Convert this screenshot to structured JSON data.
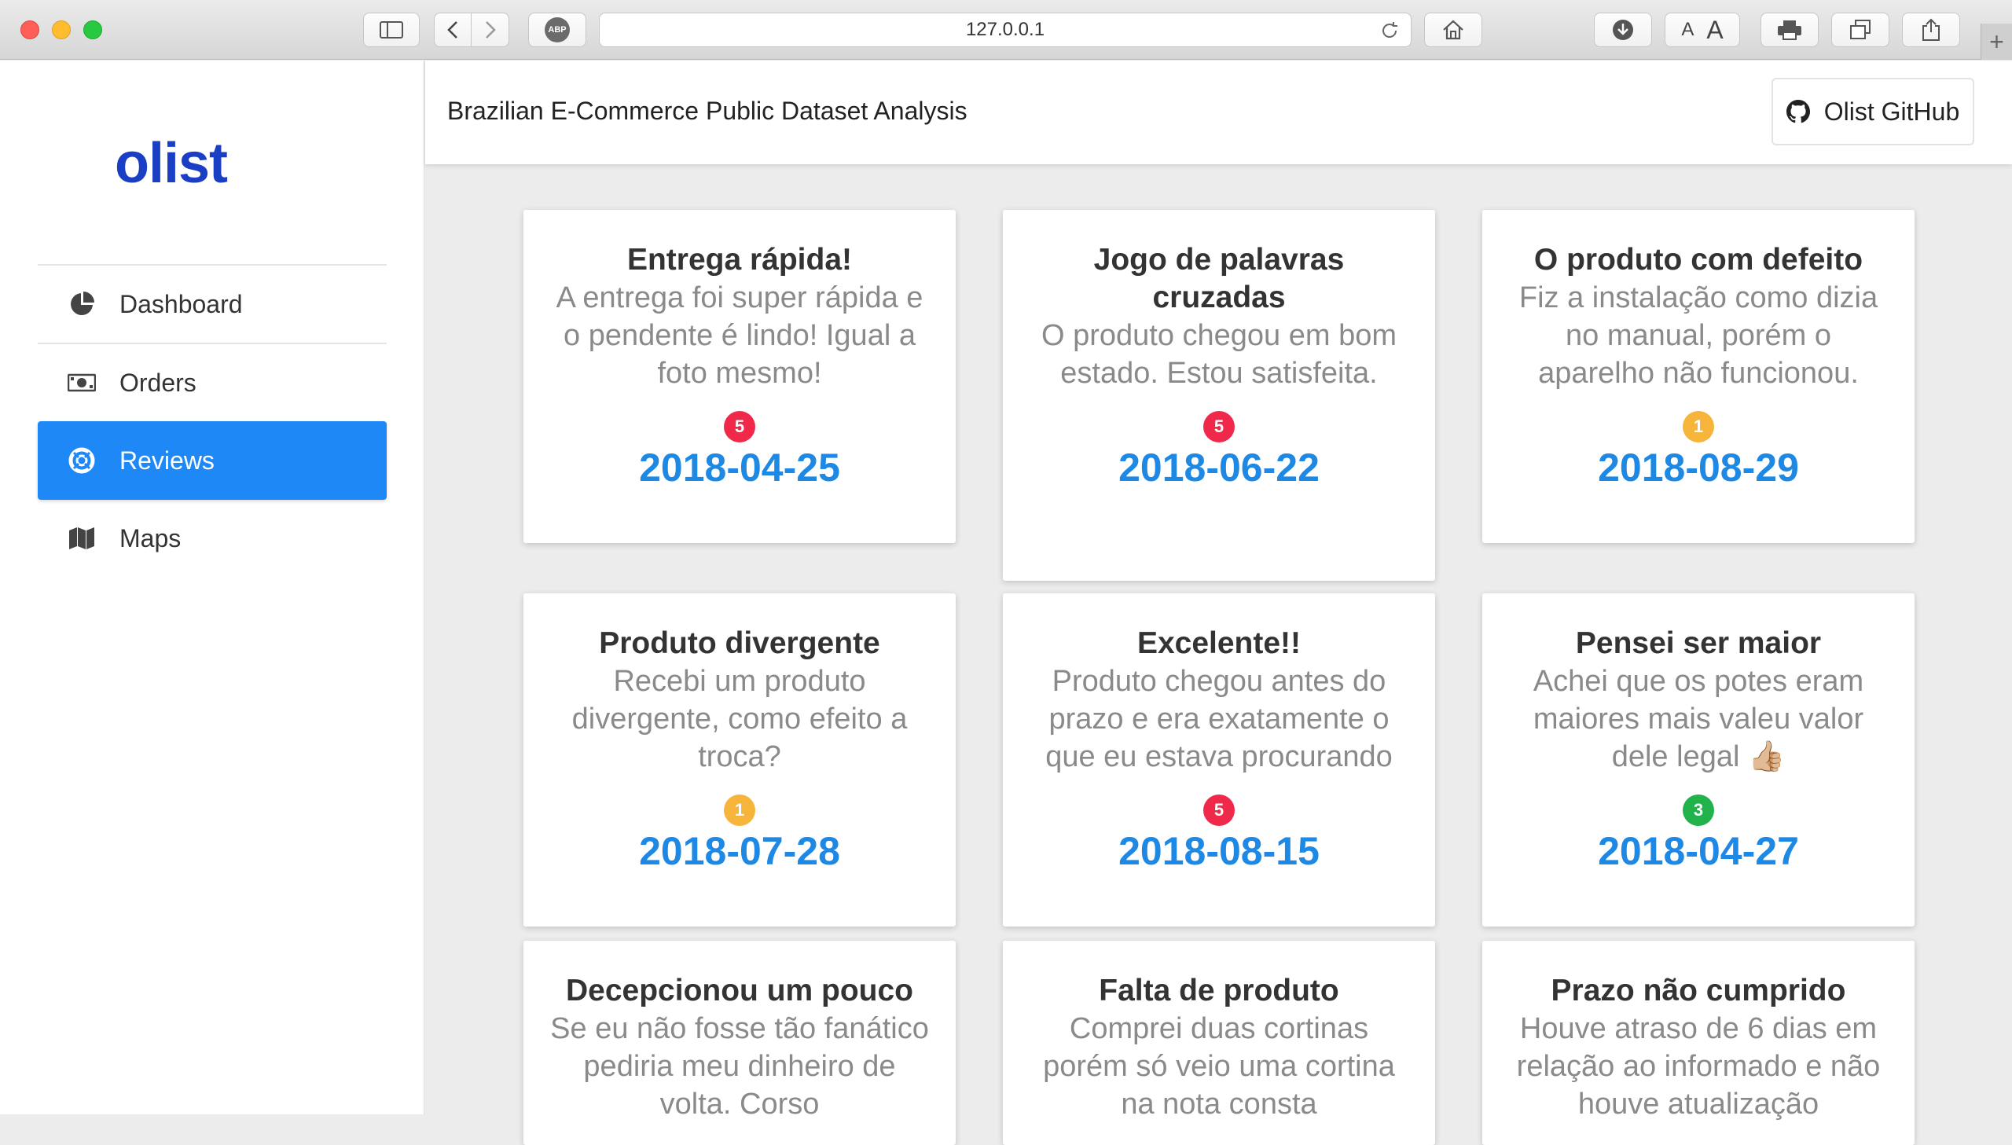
{
  "browser": {
    "url": "127.0.0.1",
    "abp_label": "ABP",
    "font_small": "A",
    "font_large": "A",
    "new_tab": "+"
  },
  "sidebar": {
    "logo": "olist",
    "items": [
      {
        "label": "Dashboard",
        "icon": "pie-chart-icon"
      },
      {
        "label": "Orders",
        "icon": "money-bill-icon"
      },
      {
        "label": "Reviews",
        "icon": "life-ring-icon",
        "active": true
      },
      {
        "label": "Maps",
        "icon": "map-icon"
      }
    ]
  },
  "header": {
    "title": "Brazilian E-Commerce Public Dataset Analysis",
    "github_label": "Olist GitHub"
  },
  "colors": {
    "accent": "#1e88f7",
    "logo": "#1a3fc4",
    "badge_red": "#f0294a",
    "badge_orange": "#f7b43a",
    "badge_green": "#22b24c"
  },
  "reviews": [
    {
      "title": "Entrega rápida!",
      "text": "A entrega foi super rápida e o pendente é lindo! Igual a foto mesmo!",
      "score": "5",
      "score_color": "red",
      "date": "2018-04-25"
    },
    {
      "title": "Jogo de palavras cruzadas",
      "text": "O produto chegou em bom estado. Estou satisfeita.",
      "score": "5",
      "score_color": "red",
      "date": "2018-06-22"
    },
    {
      "title": "O produto com defeito",
      "text": "Fiz a instalação como dizia no manual, porém o aparelho não funcionou.",
      "score": "1",
      "score_color": "orange",
      "date": "2018-08-29"
    },
    {
      "title": "Produto divergente",
      "text": "Recebi um produto divergente, como efeito a troca?",
      "score": "1",
      "score_color": "orange",
      "date": "2018-07-28"
    },
    {
      "title": "Excelente!!",
      "text": "Produto chegou antes do prazo e era exatamente o que eu estava procurando",
      "score": "5",
      "score_color": "red",
      "date": "2018-08-15"
    },
    {
      "title": "Pensei ser maior",
      "text": "Achei que os potes eram maiores mais valeu valor dele legal 👍🏼",
      "score": "3",
      "score_color": "green",
      "date": "2018-04-27"
    },
    {
      "title": "Decepcionou um pouco",
      "text": "Se eu não fosse tão fanático pediria meu dinheiro de volta. Corso",
      "score": "",
      "score_color": "red",
      "date": ""
    },
    {
      "title": "Falta de produto",
      "text": "Comprei duas cortinas porém só veio uma cortina na nota consta",
      "score": "",
      "score_color": "red",
      "date": ""
    },
    {
      "title": "Prazo não cumprido",
      "text": "Houve atraso de 6 dias em relação ao informado e não houve atualização",
      "score": "",
      "score_color": "red",
      "date": ""
    }
  ]
}
